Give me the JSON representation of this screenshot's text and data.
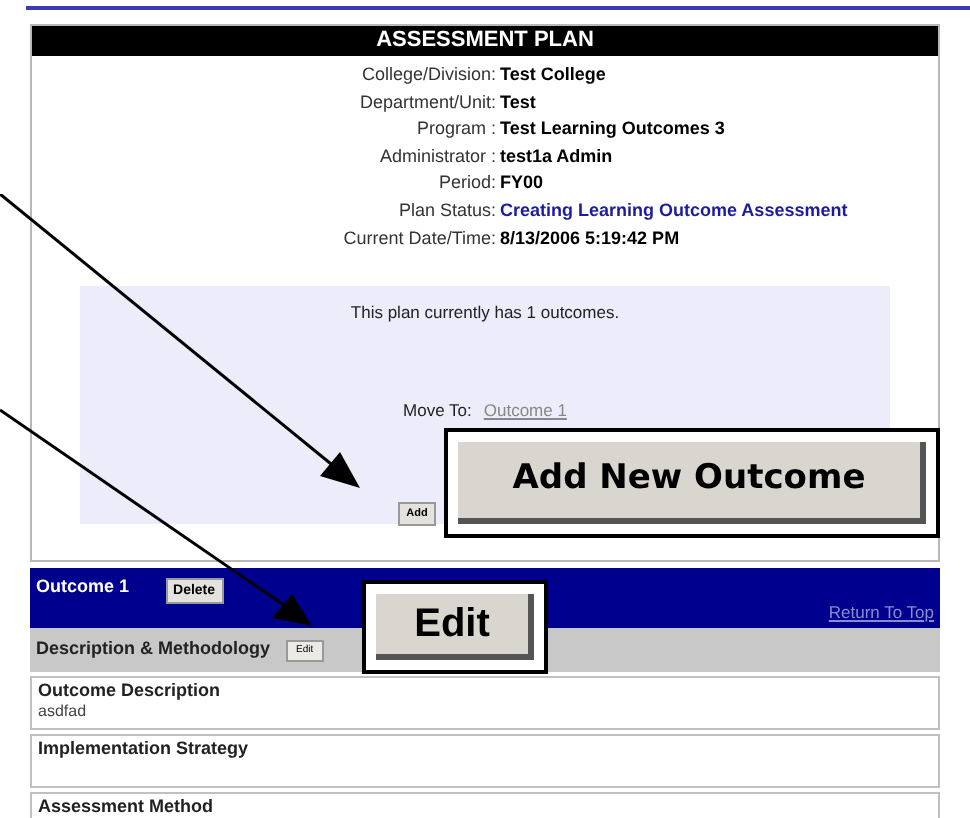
{
  "plan": {
    "title": "ASSESSMENT PLAN",
    "fields": [
      {
        "label": "College/Division:",
        "value": "Test College",
        "kind": "plain"
      },
      {
        "label": "Department/Unit:",
        "value": "Test",
        "kind": "plain"
      },
      {
        "label": "Program :",
        "value": "Test Learning Outcomes 3",
        "kind": "plain"
      },
      {
        "label": "Administrator :",
        "value": "test1a Admin",
        "kind": "plain"
      },
      {
        "label": "Period:",
        "value": "FY00",
        "kind": "plain"
      },
      {
        "label": "Plan Status:",
        "value": "Creating Learning Outcome Assessment",
        "kind": "status"
      },
      {
        "label": "Current Date/Time:",
        "value": "8/13/2006 5:19:42 PM",
        "kind": "plain"
      }
    ],
    "summary": "This plan currently has 1 outcomes.",
    "move_to_label": "Move To:",
    "move_to_link": "Outcome 1",
    "add_button": "Add"
  },
  "outcome": {
    "title": "Outcome 1",
    "delete_button": "Delete",
    "return_link": "Return To Top",
    "section": "Description & Methodology",
    "edit_button": "Edit",
    "rows": [
      {
        "label": "Outcome Description",
        "value": "asdfad"
      },
      {
        "label": "Implementation Strategy"
      },
      {
        "label": "Assessment Method"
      }
    ]
  },
  "callouts": [
    {
      "text": "Add New Outcome"
    },
    {
      "text": "Edit"
    }
  ]
}
